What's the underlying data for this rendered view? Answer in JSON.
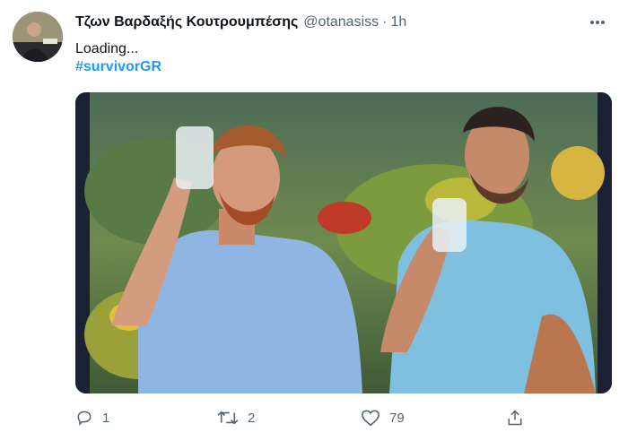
{
  "tweet": {
    "display_name": "Τζων Βαρδαξής Κουτρουμπέσης",
    "handle": "@otanasiss",
    "separator": "·",
    "time": "1h",
    "text": "Loading...",
    "hashtag": "#survivorGR",
    "media_alt_icon": "photo"
  },
  "actions": {
    "reply_count": "1",
    "retweet_count": "2",
    "like_count": "79"
  },
  "colors": {
    "accent": "#1d9bf0",
    "muted": "#536471",
    "text": "#0f1419"
  }
}
